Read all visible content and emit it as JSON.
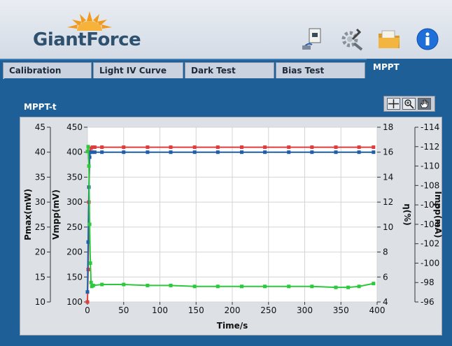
{
  "app": {
    "logo_text": "GiantForce"
  },
  "toolbar": {
    "icons": [
      "device-export-icon",
      "tools-icon",
      "folder-icon",
      "info-icon"
    ]
  },
  "tabs": [
    {
      "label": "Calibration",
      "active": false
    },
    {
      "label": "Light IV Curve",
      "active": false
    },
    {
      "label": "Dark Test",
      "active": false
    },
    {
      "label": "Bias Test",
      "active": false
    },
    {
      "label": "MPPT",
      "active": true
    }
  ],
  "graph": {
    "title": "MPPT-t",
    "palette_tools": [
      "cursor-crosshair-icon",
      "zoom-icon",
      "pan-hand-icon"
    ]
  },
  "colors": {
    "pmax": "#1f5fa8",
    "vmpp": "#e03c3c",
    "eta": "#2cc93c",
    "impp": "#2cc93c"
  },
  "chart_data": {
    "type": "line",
    "xlabel": "Time/s",
    "xlim": [
      0,
      400
    ],
    "x_ticks": [
      0,
      50,
      100,
      150,
      200,
      250,
      300,
      350,
      400
    ],
    "axes": {
      "pmax": {
        "label": "Pmax(mW)",
        "range": [
          10,
          45
        ],
        "ticks": [
          10,
          15,
          20,
          25,
          30,
          35,
          40,
          45
        ],
        "side": "left-outer"
      },
      "vmpp": {
        "label": "Vmpp(mV)",
        "range": [
          100,
          450
        ],
        "ticks": [
          100,
          150,
          200,
          250,
          300,
          350,
          400,
          450
        ],
        "side": "left-inner"
      },
      "eta": {
        "label": "η(%)",
        "range": [
          4,
          18
        ],
        "ticks": [
          4,
          6,
          8,
          10,
          12,
          14,
          16,
          18
        ],
        "side": "right-inner"
      },
      "impp": {
        "label": "Impp(mA)",
        "range": [
          -96,
          -114
        ],
        "ticks": [
          -96,
          -98,
          -100,
          -102,
          -104,
          -106,
          -108,
          -110,
          -112,
          -114
        ],
        "side": "right-outer"
      }
    },
    "grid": true,
    "series": [
      {
        "axis": "vmpp",
        "marker": "square",
        "x": [
          0,
          1,
          2,
          3,
          5,
          7,
          10,
          20,
          50,
          83,
          115,
          148,
          180,
          213,
          245,
          278,
          310,
          343,
          375,
          395
        ],
        "y": [
          100,
          165,
          300,
          400,
          408,
          410,
          410,
          410,
          410,
          410,
          410,
          410,
          410,
          410,
          410,
          410,
          410,
          410,
          410,
          410
        ]
      },
      {
        "axis": "pmax",
        "marker": "square",
        "x": [
          0,
          1,
          2,
          3,
          4,
          6,
          10,
          20,
          50,
          83,
          115,
          148,
          180,
          213,
          245,
          278,
          310,
          343,
          375,
          395
        ],
        "y": [
          12,
          22,
          33,
          39,
          40,
          40,
          40,
          40,
          40,
          40,
          40,
          40,
          40,
          40,
          40,
          40,
          40,
          40,
          40,
          40
        ]
      },
      {
        "axis": "impp",
        "marker": "square",
        "x": [
          0,
          1,
          2,
          3,
          4,
          5,
          6,
          8,
          20,
          50,
          83,
          115,
          148,
          180,
          213,
          245,
          278,
          310,
          343,
          360,
          375,
          395
        ],
        "y": [
          -111.5,
          -112,
          -110,
          -104,
          -100,
          -98,
          -97.6,
          -97.7,
          -97.8,
          -97.8,
          -97.7,
          -97.7,
          -97.6,
          -97.6,
          -97.6,
          -97.6,
          -97.6,
          -97.6,
          -97.5,
          -97.5,
          -97.6,
          -97.9
        ]
      }
    ]
  }
}
